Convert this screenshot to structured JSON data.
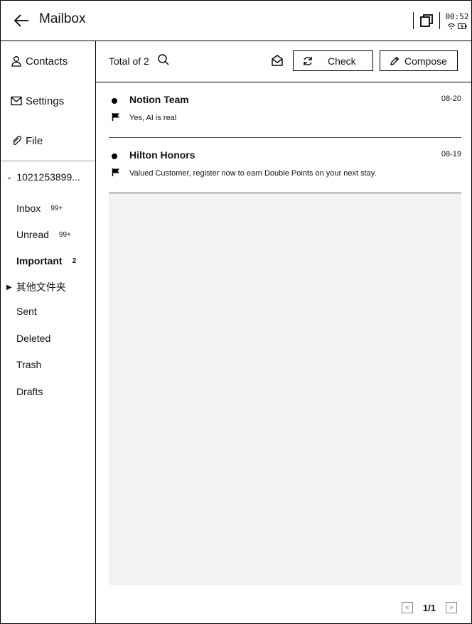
{
  "header": {
    "title": "Mailbox",
    "clock": "00:52",
    "back_icon": "back-arrow-icon"
  },
  "sidebar": {
    "top_items": [
      {
        "label": "Contacts",
        "icon": "person-icon"
      },
      {
        "label": "Settings",
        "icon": "mail-settings-icon"
      },
      {
        "label": "File",
        "icon": "paperclip-icon"
      }
    ],
    "account": "1021253899...",
    "folders": [
      {
        "label": "Inbox",
        "count": "99+"
      },
      {
        "label": "Unread",
        "count": "99+"
      },
      {
        "label": "Important",
        "count": "2"
      },
      {
        "label": "其他文件夹",
        "count": ""
      },
      {
        "label": "Sent",
        "count": ""
      },
      {
        "label": "Deleted",
        "count": ""
      },
      {
        "label": "Trash",
        "count": ""
      },
      {
        "label": "Drafts",
        "count": ""
      }
    ]
  },
  "toolbar": {
    "total_label": "Total of 2",
    "check_label": "Check",
    "compose_label": "Compose"
  },
  "mails": [
    {
      "sender": "Notion Team",
      "date": "08-20",
      "subject": "Yes, AI is real"
    },
    {
      "sender": "Hilton Honors",
      "date": "08-19",
      "subject": "Valued Customer, register now to earn Double Points on your next stay."
    }
  ],
  "pager": {
    "text": "1/1"
  }
}
